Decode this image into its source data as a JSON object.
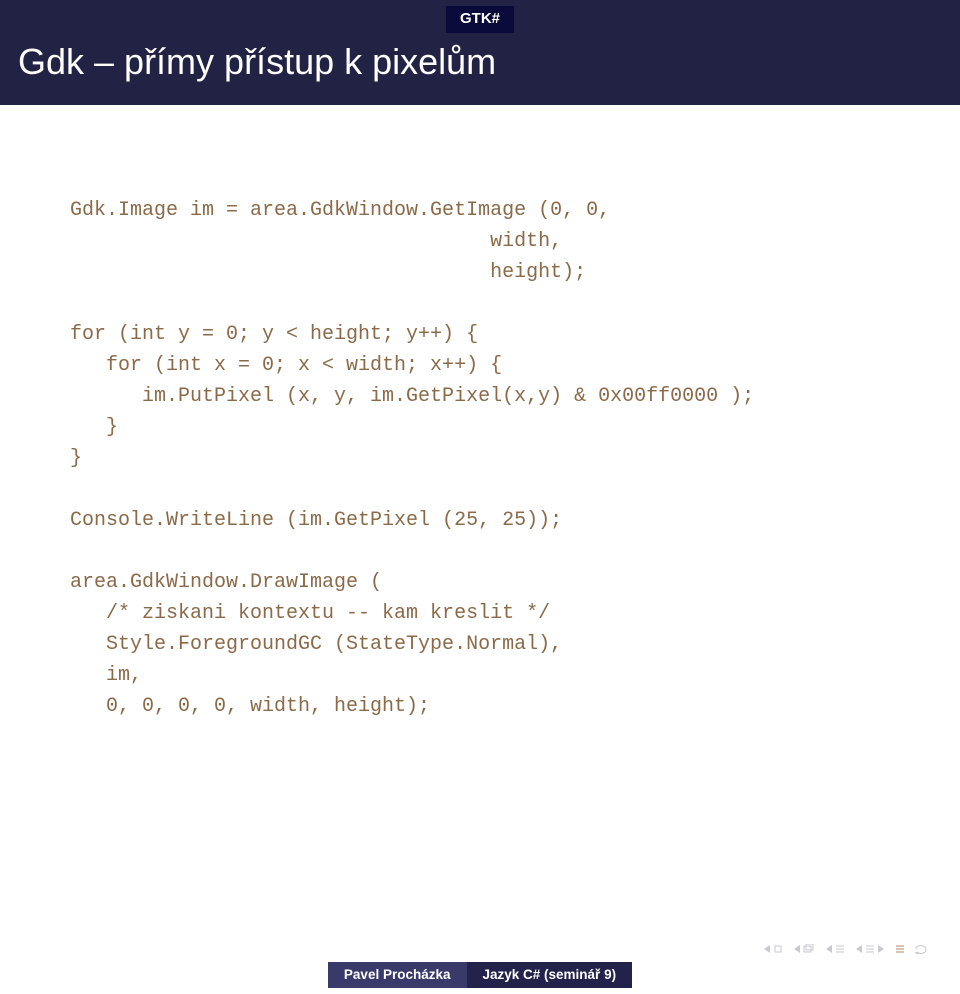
{
  "header": {
    "section": "GTK#",
    "title": "Gdk – přímy přístup k pixelům"
  },
  "code": {
    "l01": "Gdk.Image im = area.GdkWindow.GetImage (0, 0,",
    "l02": "                                   width,",
    "l03": "                                   height);",
    "l04": "",
    "l05": "for (int y = 0; y < height; y++) {",
    "l06": "   for (int x = 0; x < width; x++) {",
    "l07": "      im.PutPixel (x, y, im.GetPixel(x,y) & 0x00ff0000 );",
    "l08": "   }",
    "l09": "}",
    "l10": "",
    "l11": "Console.WriteLine (im.GetPixel (25, 25));",
    "l12": "",
    "l13": "area.GdkWindow.DrawImage (",
    "l14": "   /* ziskani kontextu -- kam kreslit */",
    "l15": "   Style.ForegroundGC (StateType.Normal),",
    "l16": "   im,",
    "l17": "   0, 0, 0, 0, width, height);"
  },
  "footer": {
    "author": "Pavel Procházka",
    "talk": "Jazyk C# (seminář 9)"
  }
}
